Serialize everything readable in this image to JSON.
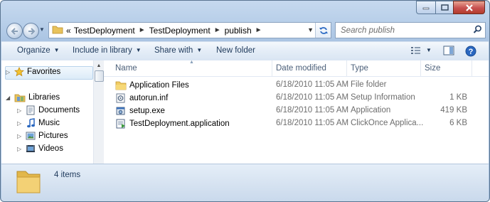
{
  "address": {
    "overflow": "«",
    "crumbs": [
      "TestDeployment",
      "TestDeployment",
      "publish"
    ]
  },
  "search": {
    "placeholder": "Search publish"
  },
  "toolbar": {
    "organize": "Organize",
    "include_in_library": "Include in library",
    "share_with": "Share with",
    "new_folder": "New folder"
  },
  "sidebar": {
    "favorites": "Favorites",
    "libraries": "Libraries",
    "items": [
      "Documents",
      "Music",
      "Pictures",
      "Videos"
    ]
  },
  "columns": {
    "name": "Name",
    "date": "Date modified",
    "type": "Type",
    "size": "Size"
  },
  "files": [
    {
      "name": "Application Files",
      "date": "6/18/2010 11:05 AM",
      "type": "File folder",
      "size": "",
      "icon": "folder-icon"
    },
    {
      "name": "autorun.inf",
      "date": "6/18/2010 11:05 AM",
      "type": "Setup Information",
      "size": "1 KB",
      "icon": "setup-info-icon"
    },
    {
      "name": "setup.exe",
      "date": "6/18/2010 11:05 AM",
      "type": "Application",
      "size": "419 KB",
      "icon": "setup-exe-icon"
    },
    {
      "name": "TestDeployment.application",
      "date": "6/18/2010 11:05 AM",
      "type": "ClickOnce Applica...",
      "size": "6 KB",
      "icon": "clickonce-icon"
    }
  ],
  "details": {
    "count": "4 items"
  },
  "colors": {
    "frame": "#b8cfe9",
    "toolbar": "#e4edf7",
    "header_text": "#4c607a",
    "close": "#c75050"
  }
}
